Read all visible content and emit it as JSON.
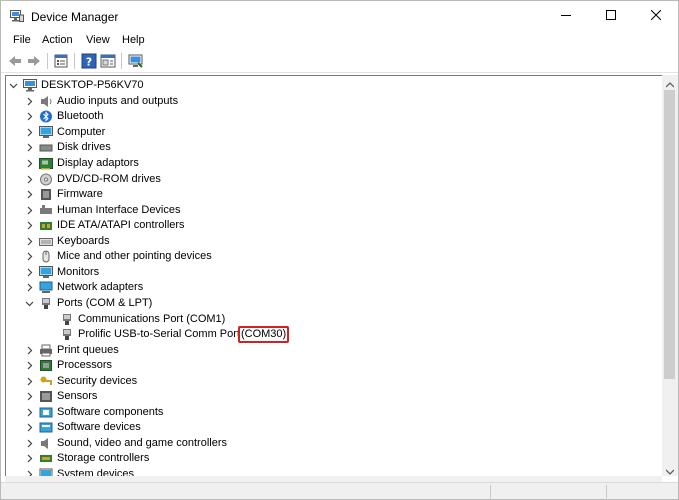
{
  "window": {
    "title": "Device Manager",
    "minimize_icon": "minimize-icon",
    "maximize_icon": "maximize-icon",
    "close_icon": "close-icon"
  },
  "menu": {
    "file": "File",
    "action": "Action",
    "view": "View",
    "help": "Help"
  },
  "toolbar": {
    "icons": [
      "back-arrow-icon",
      "forward-arrow-icon",
      "properties-icon",
      "help-icon",
      "show-hide-icon",
      "scan-hardware-icon"
    ]
  },
  "tree": {
    "root": "DESKTOP-P56KV70",
    "categories": [
      {
        "label": "Audio inputs and outputs",
        "icon": "speaker-icon"
      },
      {
        "label": "Bluetooth",
        "icon": "bluetooth-icon"
      },
      {
        "label": "Computer",
        "icon": "computer-icon"
      },
      {
        "label": "Disk drives",
        "icon": "disk-drive-icon"
      },
      {
        "label": "Display adaptors",
        "icon": "display-adapter-icon"
      },
      {
        "label": "DVD/CD-ROM drives",
        "icon": "dvd-drive-icon"
      },
      {
        "label": "Firmware",
        "icon": "firmware-icon"
      },
      {
        "label": "Human Interface Devices",
        "icon": "hid-icon"
      },
      {
        "label": "IDE ATA/ATAPI controllers",
        "icon": "ide-controller-icon"
      },
      {
        "label": "Keyboards",
        "icon": "keyboard-icon"
      },
      {
        "label": "Mice and other pointing devices",
        "icon": "mouse-icon"
      },
      {
        "label": "Monitors",
        "icon": "monitor-icon"
      },
      {
        "label": "Network adapters",
        "icon": "network-adapter-icon"
      },
      {
        "label": "Ports (COM & LPT)",
        "icon": "port-icon",
        "expanded": true
      }
    ],
    "ports_children": [
      {
        "label": "Communications Port (COM1)",
        "icon": "port-icon"
      },
      {
        "label": "Prolific USB-to-Serial Comm Port ",
        "highlight": "(COM30)",
        "icon": "port-icon"
      }
    ],
    "categories_after": [
      {
        "label": "Print queues",
        "icon": "printer-icon"
      },
      {
        "label": "Processors",
        "icon": "processor-icon"
      },
      {
        "label": "Security devices",
        "icon": "security-key-icon"
      },
      {
        "label": "Sensors",
        "icon": "sensor-icon"
      },
      {
        "label": "Software components",
        "icon": "software-component-icon"
      },
      {
        "label": "Software devices",
        "icon": "software-device-icon"
      },
      {
        "label": "Sound, video and game controllers",
        "icon": "sound-icon"
      },
      {
        "label": "Storage controllers",
        "icon": "storage-controller-icon"
      },
      {
        "label": "System devices",
        "icon": "system-device-icon"
      }
    ]
  },
  "colors": {
    "highlight_border": "#d42020",
    "window_border": "#b9b9b9"
  }
}
